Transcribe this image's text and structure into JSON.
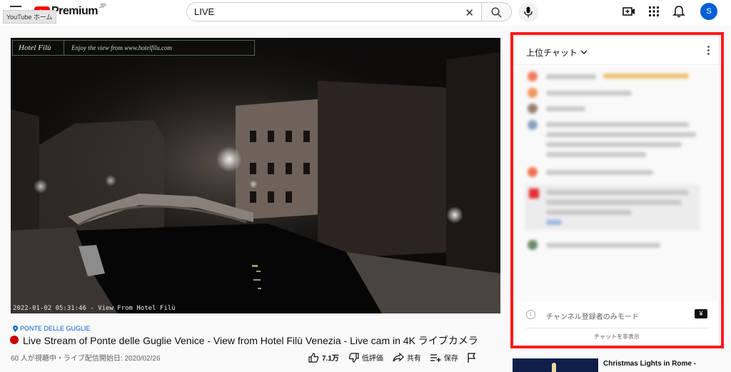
{
  "header": {
    "logo_text": "Premium",
    "logo_region": "JP",
    "tooltip": "YouTube ホーム",
    "search_value": "LIVE",
    "avatar_initial": "S",
    "icons": [
      "menu-icon",
      "youtube-logo",
      "clear-icon",
      "search-icon",
      "mic-icon",
      "create-icon",
      "apps-icon",
      "bell-icon",
      "avatar"
    ]
  },
  "player": {
    "watermark_logo": "Hotel Filù",
    "watermark_text": "Enjoy the view from www.hotelfilu.com",
    "timestamp": "2022-01-02 05:31:46 - View From Hotel Filù"
  },
  "video": {
    "location": "PONTE DELLE GUGLIE",
    "title": "Live Stream of Ponte delle Guglie Venice - View from Hotel Filù Venezia - Live cam in 4K ライブカメラ",
    "meta": "60 人が視聴中・ライブ配信開始日: 2020/02/26",
    "actions": {
      "like": "7.1万",
      "dislike": "低評価",
      "share": "共有",
      "save": "保存"
    }
  },
  "chat": {
    "title": "上位チャット",
    "subscriber_mode": "チャンネル登録者のみモード",
    "yen_icon": "¥",
    "hide_chat": "チャットを非表示"
  },
  "recommendation": {
    "title": "Christmas Lights in Rome - "
  },
  "colors": {
    "brand_red": "#ff0000",
    "highlight": "#ff1a1a",
    "link_blue": "#065fd4"
  }
}
